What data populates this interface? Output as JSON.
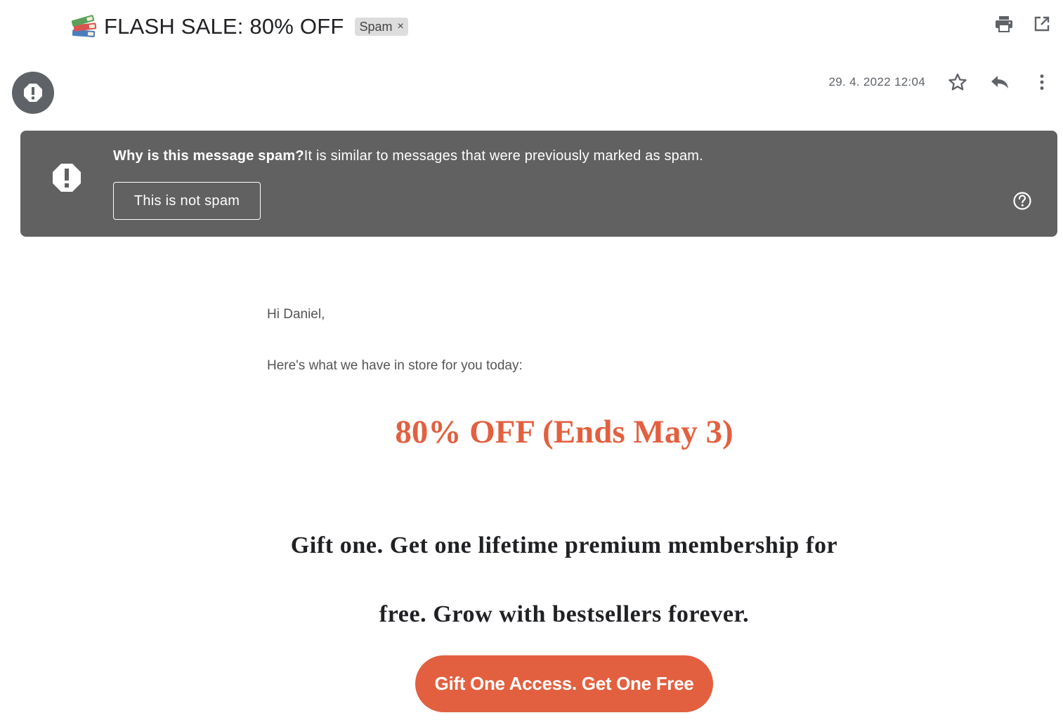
{
  "subject": {
    "emoji_icon": "books-icon",
    "title": "FLASH SALE: 80% OFF",
    "label_chip": "Spam",
    "label_remove": "×"
  },
  "toolbar": {
    "print_icon": "print-icon",
    "open_new_window_icon": "open-in-new-icon"
  },
  "message_meta": {
    "avatar_icon": "spam-alert-icon",
    "date": "29. 4. 2022 12:04",
    "star_icon": "star-outline-icon",
    "reply_icon": "reply-icon",
    "more_icon": "more-vertical-icon"
  },
  "spam_banner": {
    "icon": "spam-alert-icon",
    "question": "Why is this message spam?",
    "explanation": "It is similar to messages that were previously marked as spam.",
    "not_spam_button": "This is not spam",
    "help_icon": "help-circle-icon",
    "background": "#616161"
  },
  "body": {
    "greeting": "Hi Daniel,",
    "intro": "Here's what we have in store for you today:",
    "headline": "80% OFF (Ends May 3)",
    "promo": "Gift one. Get one lifetime premium membership for free. Grow with bestsellers forever.",
    "cta": "Gift One Access. Get One Free",
    "accent_color": "#e2603f"
  }
}
